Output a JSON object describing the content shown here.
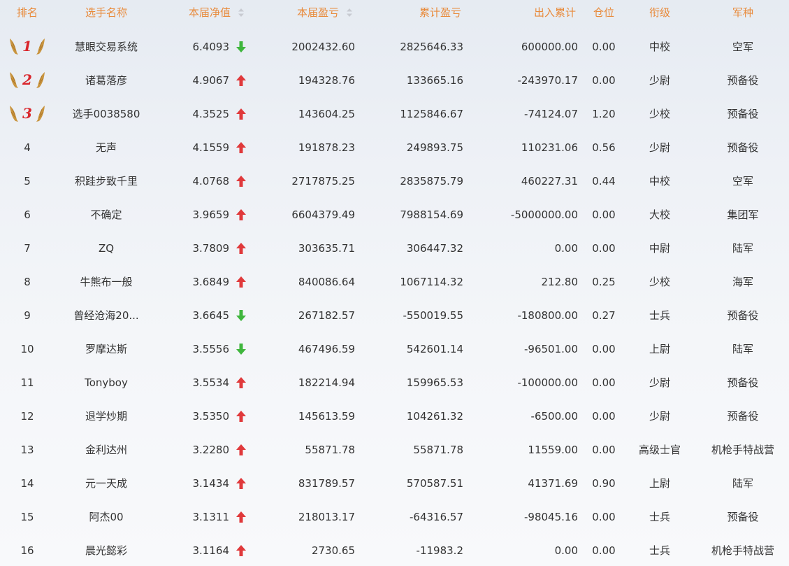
{
  "colors": {
    "header_text": "#e88a3a",
    "up_arrow": "#e0393b",
    "down_arrow": "#3fb63d",
    "medal_number": "#d9262c",
    "wing": "#c9953f"
  },
  "headers": {
    "rank": "排名",
    "name": "选手名称",
    "nav": "本届净值",
    "profit": "本届盈亏",
    "total_profit": "累计盈亏",
    "cash_flow": "出入累计",
    "position": "仓位",
    "grade": "衔级",
    "branch": "军种"
  },
  "rows": [
    {
      "rank": "1",
      "name": "慧眼交易系统",
      "nav": "6.4093",
      "trend": "down",
      "profit": "2002432.60",
      "total_profit": "2825646.33",
      "cash_flow": "600000.00",
      "position": "0.00",
      "grade": "中校",
      "branch": "空军"
    },
    {
      "rank": "2",
      "name": "诸葛落彦",
      "nav": "4.9067",
      "trend": "up",
      "profit": "194328.76",
      "total_profit": "133665.16",
      "cash_flow": "-243970.17",
      "position": "0.00",
      "grade": "少尉",
      "branch": "预备役"
    },
    {
      "rank": "3",
      "name": "选手0038580",
      "nav": "4.3525",
      "trend": "up",
      "profit": "143604.25",
      "total_profit": "1125846.67",
      "cash_flow": "-74124.07",
      "position": "1.20",
      "grade": "少校",
      "branch": "预备役"
    },
    {
      "rank": "4",
      "name": "无声",
      "nav": "4.1559",
      "trend": "up",
      "profit": "191878.23",
      "total_profit": "249893.75",
      "cash_flow": "110231.06",
      "position": "0.56",
      "grade": "少尉",
      "branch": "预备役"
    },
    {
      "rank": "5",
      "name": "积跬步致千里",
      "nav": "4.0768",
      "trend": "up",
      "profit": "2717875.25",
      "total_profit": "2835875.79",
      "cash_flow": "460227.31",
      "position": "0.44",
      "grade": "中校",
      "branch": "空军"
    },
    {
      "rank": "6",
      "name": "不确定",
      "nav": "3.9659",
      "trend": "up",
      "profit": "6604379.49",
      "total_profit": "7988154.69",
      "cash_flow": "-5000000.00",
      "position": "0.00",
      "grade": "大校",
      "branch": "集团军"
    },
    {
      "rank": "7",
      "name": "ZQ",
      "nav": "3.7809",
      "trend": "up",
      "profit": "303635.71",
      "total_profit": "306447.32",
      "cash_flow": "0.00",
      "position": "0.00",
      "grade": "中尉",
      "branch": "陆军"
    },
    {
      "rank": "8",
      "name": "牛熊布一般",
      "nav": "3.6849",
      "trend": "up",
      "profit": "840086.64",
      "total_profit": "1067114.32",
      "cash_flow": "212.80",
      "position": "0.25",
      "grade": "少校",
      "branch": "海军"
    },
    {
      "rank": "9",
      "name": "曾经沧海20...",
      "nav": "3.6645",
      "trend": "down",
      "profit": "267182.57",
      "total_profit": "-550019.55",
      "cash_flow": "-180800.00",
      "position": "0.27",
      "grade": "士兵",
      "branch": "预备役"
    },
    {
      "rank": "10",
      "name": "罗摩达斯",
      "nav": "3.5556",
      "trend": "down",
      "profit": "467496.59",
      "total_profit": "542601.14",
      "cash_flow": "-96501.00",
      "position": "0.00",
      "grade": "上尉",
      "branch": "陆军"
    },
    {
      "rank": "11",
      "name": "Tonyboy",
      "nav": "3.5534",
      "trend": "up",
      "profit": "182214.94",
      "total_profit": "159965.53",
      "cash_flow": "-100000.00",
      "position": "0.00",
      "grade": "少尉",
      "branch": "预备役"
    },
    {
      "rank": "12",
      "name": "退学炒期",
      "nav": "3.5350",
      "trend": "up",
      "profit": "145613.59",
      "total_profit": "104261.32",
      "cash_flow": "-6500.00",
      "position": "0.00",
      "grade": "少尉",
      "branch": "预备役"
    },
    {
      "rank": "13",
      "name": "金利达州",
      "nav": "3.2280",
      "trend": "up",
      "profit": "55871.78",
      "total_profit": "55871.78",
      "cash_flow": "11559.00",
      "position": "0.00",
      "grade": "高级士官",
      "branch": "机枪手特战营"
    },
    {
      "rank": "14",
      "name": "元一天成",
      "nav": "3.1434",
      "trend": "up",
      "profit": "831789.57",
      "total_profit": "570587.51",
      "cash_flow": "41371.69",
      "position": "0.90",
      "grade": "上尉",
      "branch": "陆军"
    },
    {
      "rank": "15",
      "name": "阿杰00",
      "nav": "3.1311",
      "trend": "up",
      "profit": "218013.17",
      "total_profit": "-64316.57",
      "cash_flow": "-98045.16",
      "position": "0.00",
      "grade": "士兵",
      "branch": "预备役"
    },
    {
      "rank": "16",
      "name": "晨光懿彩",
      "nav": "3.1164",
      "trend": "up",
      "profit": "2730.65",
      "total_profit": "-11983.2",
      "cash_flow": "0.00",
      "position": "0.00",
      "grade": "士兵",
      "branch": "机枪手特战营"
    }
  ]
}
